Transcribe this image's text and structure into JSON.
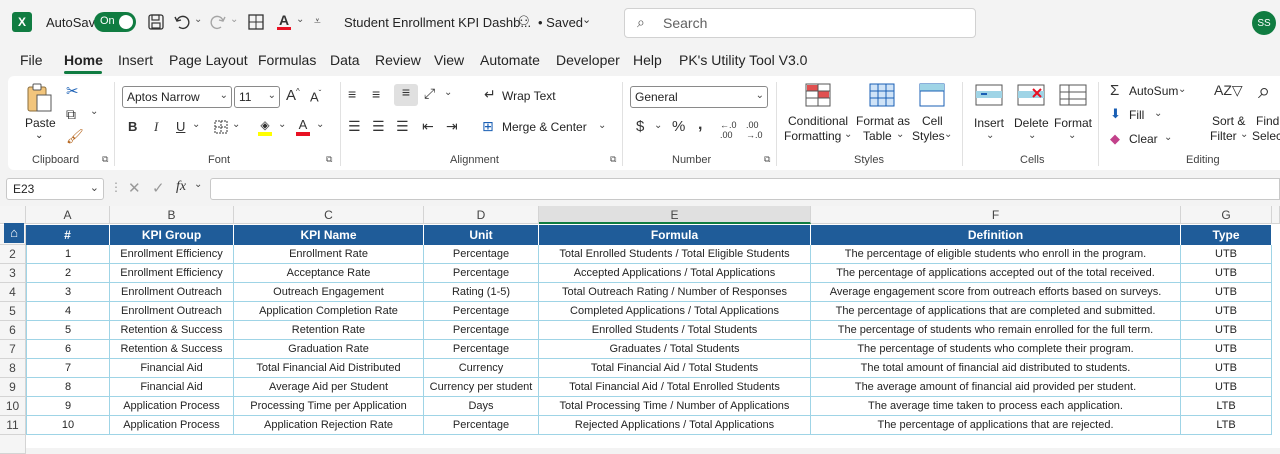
{
  "titlebar": {
    "autosave_label": "AutoSave",
    "autosave_state": "On",
    "doc_title": "Student Enrollment KPI Dashb...",
    "saved_label": "• Saved",
    "search_placeholder": "Search",
    "avatar_initials": "SS"
  },
  "menu": {
    "items": [
      "File",
      "Home",
      "Insert",
      "Page Layout",
      "Formulas",
      "Data",
      "Review",
      "View",
      "Automate",
      "Developer",
      "Help",
      "PK's Utility Tool V3.0"
    ],
    "active": "Home"
  },
  "ribbon": {
    "clipboard": {
      "paste_label": "Paste",
      "group_label": "Clipboard"
    },
    "font": {
      "font_name": "Aptos Narrow",
      "font_size": "11",
      "group_label": "Font"
    },
    "alignment": {
      "wrap_text": "Wrap Text",
      "merge_center": "Merge & Center",
      "group_label": "Alignment"
    },
    "number": {
      "format": "General",
      "group_label": "Number"
    },
    "styles": {
      "conditional_line1": "Conditional",
      "conditional_line2": "Formatting",
      "format_table_line1": "Format as",
      "format_table_line2": "Table",
      "cell_styles_line1": "Cell",
      "cell_styles_line2": "Styles",
      "group_label": "Styles"
    },
    "cells": {
      "insert": "Insert",
      "delete": "Delete",
      "format": "Format",
      "group_label": "Cells"
    },
    "editing": {
      "autosum": "AutoSum",
      "fill": "Fill",
      "clear": "Clear",
      "sort_line1": "Sort &",
      "sort_line2": "Filter",
      "find_line1": "Find",
      "find_line2": "Selec",
      "group_label": "Editing"
    }
  },
  "formula_bar": {
    "name_box": "E23",
    "fx": "fx",
    "content": ""
  },
  "sheet": {
    "columns": [
      "A",
      "B",
      "C",
      "D",
      "E",
      "F",
      "G"
    ],
    "header": [
      "#",
      "KPI Group",
      "KPI Name",
      "Unit",
      "Formula",
      "Definition",
      "Type"
    ],
    "row_numbers": [
      "1",
      "2",
      "3",
      "4",
      "5",
      "6",
      "7",
      "8",
      "9",
      "10",
      "11"
    ],
    "rows": [
      [
        "1",
        "Enrollment Efficiency",
        "Enrollment Rate",
        "Percentage",
        "Total Enrolled Students / Total Eligible Students",
        "The percentage of eligible students who enroll in the program.",
        "UTB"
      ],
      [
        "2",
        "Enrollment Efficiency",
        "Acceptance Rate",
        "Percentage",
        "Accepted Applications / Total Applications",
        "The percentage of applications accepted out of the total received.",
        "UTB"
      ],
      [
        "3",
        "Enrollment Outreach",
        "Outreach Engagement",
        "Rating (1-5)",
        "Total Outreach Rating / Number of Responses",
        "Average engagement score from outreach efforts based on surveys.",
        "UTB"
      ],
      [
        "4",
        "Enrollment Outreach",
        "Application Completion Rate",
        "Percentage",
        "Completed Applications / Total Applications",
        "The percentage of applications that are completed and submitted.",
        "UTB"
      ],
      [
        "5",
        "Retention & Success",
        "Retention Rate",
        "Percentage",
        "Enrolled Students / Total Students",
        "The percentage of students who remain enrolled for the full term.",
        "UTB"
      ],
      [
        "6",
        "Retention & Success",
        "Graduation Rate",
        "Percentage",
        "Graduates / Total Students",
        "The percentage of students who complete their program.",
        "UTB"
      ],
      [
        "7",
        "Financial Aid",
        "Total Financial Aid Distributed",
        "Currency",
        "Total Financial Aid / Total Students",
        "The total amount of financial aid distributed to students.",
        "UTB"
      ],
      [
        "8",
        "Financial Aid",
        "Average Aid per Student",
        "Currency per student",
        "Total Financial Aid / Total Enrolled Students",
        "The average amount of financial aid provided per student.",
        "UTB"
      ],
      [
        "9",
        "Application Process",
        "Processing Time per Application",
        "Days",
        "Total Processing Time / Number of Applications",
        "The average time taken to process each application.",
        "LTB"
      ],
      [
        "10",
        "Application Process",
        "Application Rejection Rate",
        "Percentage",
        "Rejected Applications / Total Applications",
        "The percentage of applications that are rejected.",
        "LTB"
      ]
    ]
  },
  "colors": {
    "accent_green": "#107c41",
    "header_blue": "#1f5c99",
    "grid_line": "#9fd4e6"
  }
}
